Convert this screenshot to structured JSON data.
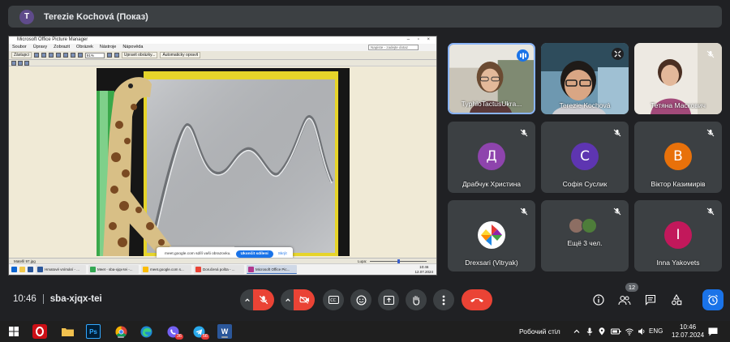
{
  "presenter": {
    "initial": "T",
    "label": "Terezie Kochová (Показ)"
  },
  "shared_screen": {
    "app_title": "Microsoft Office Picture Manager",
    "menu": [
      "Soubor",
      "Úpravy",
      "Zobrazit",
      "Obrázek",
      "Nástroje",
      "Nápověda"
    ],
    "help_placeholder": "Napiste - zadejte dotaz",
    "toolbar": {
      "shortcuts": "Zástupci",
      "zoom": "91%",
      "edit": "Upravit obrázky...",
      "auto": "Automaticky opravit"
    },
    "status_file": "Matefil 97.jpg",
    "status_zoom": "Lupa:",
    "share_prompt": "meet.google.com sdílí vaši obrazovku.",
    "stop_sharing": "Ukončit sdílení",
    "hide": "Skrýt",
    "tasks": [
      "Hmatové vnímání - ...",
      "Meet - sba-xjqx-tei -...",
      "meet.google.com s...",
      "Doručená pošta - ...",
      "Microsoft Office Pic..."
    ],
    "tray_time": "10:46",
    "tray_date": "12.07.2024"
  },
  "participants": [
    {
      "name": "TyphloTactusUkra...",
      "state": "speaking"
    },
    {
      "name": "Terezie Kochová",
      "state": "pinned"
    },
    {
      "name": "Тетяна Маскович",
      "state": "muted"
    },
    {
      "name": "Драбчук Христина",
      "initial": "Д",
      "color": "#8e44ad",
      "state": "muted"
    },
    {
      "name": "Софія Суслик",
      "initial": "С",
      "color": "#5e35b1",
      "state": "muted"
    },
    {
      "name": "Віктор Казимирів",
      "initial": "В",
      "color": "#e8710a",
      "state": "muted"
    },
    {
      "name": "Drexsari (Vitryak)",
      "state": "muted"
    },
    {
      "name": "Ещё 3 чел.",
      "state": "muted"
    },
    {
      "name": "Inna Yakovets",
      "initial": "I",
      "color": "#c2185b",
      "state": "muted"
    }
  ],
  "meeting": {
    "time": "10:46",
    "code": "sba-xjqx-tei",
    "participant_count": "12"
  },
  "colors": {
    "background": "#202124",
    "tile": "#3c4043",
    "accent": "#1a73e8",
    "danger": "#ea4335",
    "speaking_ring": "#8ab4f8"
  },
  "windows_taskbar": {
    "desktop_label": "Робочий стіл",
    "lang": "ENG",
    "time": "10:46",
    "date": "12.07.2024",
    "viber_badge": "36",
    "telegram_badge": "56"
  }
}
